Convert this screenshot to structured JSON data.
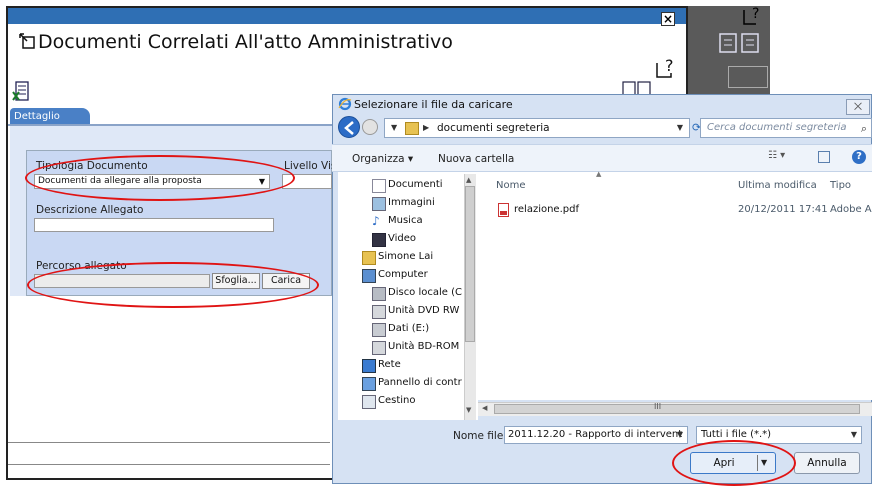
{
  "back_window": {
    "close_glyph": "×",
    "title": "Documenti Correlati All'atto Amministrativo",
    "tab_label": "Dettaglio",
    "form": {
      "tipologia_label": "Tipologia Documento",
      "tipologia_value": "Documenti da allegare alla proposta",
      "livello_label": "Livello Vis",
      "descrizione_label": "Descrizione Allegato",
      "percorso_label": "Percorso allegato",
      "sfoglia_button": "Sfoglia...",
      "carica_button": "Carica"
    }
  },
  "dialog": {
    "title": "Selezionare il file da caricare",
    "close_glyph": "⨉",
    "address_path": "documenti segreteria",
    "search_placeholder": "Cerca documenti segreteria",
    "toolbar": {
      "organizza": "Organizza ▾",
      "nuova_cartella": "Nuova cartella"
    },
    "nav_items": [
      {
        "label": "Documenti",
        "icon": "documents-icon"
      },
      {
        "label": "Immagini",
        "icon": "images-icon"
      },
      {
        "label": "Musica",
        "icon": "music-icon"
      },
      {
        "label": "Video",
        "icon": "video-icon"
      },
      {
        "label": "Simone Lai",
        "icon": "user-folder-icon"
      },
      {
        "label": "Computer",
        "icon": "computer-icon"
      },
      {
        "label": "Disco locale (C",
        "icon": "local-disk-icon"
      },
      {
        "label": "Unità DVD RW",
        "icon": "dvd-drive-icon"
      },
      {
        "label": "Dati (E:)",
        "icon": "drive-icon"
      },
      {
        "label": "Unità BD-ROM",
        "icon": "bd-drive-icon"
      },
      {
        "label": "Rete",
        "icon": "network-icon"
      },
      {
        "label": "Pannello di contr",
        "icon": "control-panel-icon"
      },
      {
        "label": "Cestino",
        "icon": "recycle-bin-icon"
      }
    ],
    "columns": {
      "nome": "Nome",
      "ultima_modifica": "Ultima modifica",
      "tipo": "Tipo"
    },
    "files": [
      {
        "name": "relazione.pdf",
        "modified": "20/12/2011 17:41",
        "type": "Adobe A"
      }
    ],
    "scroll_mid": "III",
    "nome_file_label": "Nome file:",
    "nome_file_value": "2011.12.20 - Rapporto di intervent",
    "filter_value": "Tutti i file (*.*)",
    "apri_button": "Apri",
    "annulla_button": "Annulla"
  },
  "colors": {
    "annotation_red": "#e01414",
    "title_bar_blue": "#2f6fb4",
    "tab_blue": "#4a80c6",
    "dialog_bg": "#d6e2f3"
  }
}
